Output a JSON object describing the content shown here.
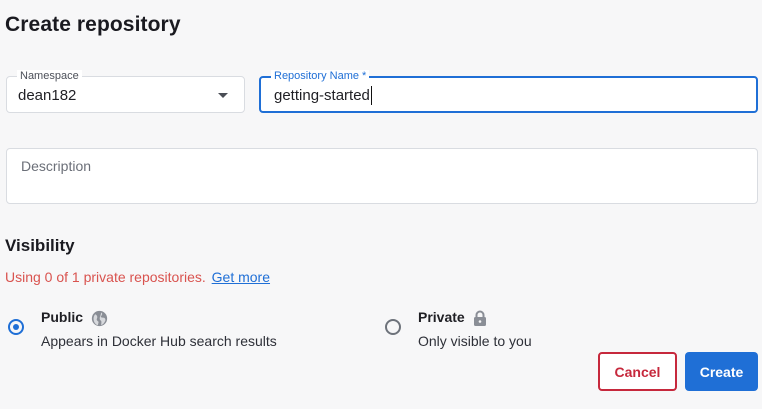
{
  "page": {
    "title": "Create repository"
  },
  "namespace": {
    "label": "Namespace",
    "value": "dean182",
    "icon": "chevron-down-icon"
  },
  "repository_name": {
    "label": "Repository Name *",
    "value": "getting-started"
  },
  "description": {
    "placeholder": "Description"
  },
  "visibility": {
    "title": "Visibility",
    "usage_text": "Using 0 of 1 private repositories.",
    "get_more_link": "Get more",
    "options": [
      {
        "title": "Public",
        "icon": "globe-icon",
        "description": "Appears in Docker Hub search results",
        "selected": true
      },
      {
        "title": "Private",
        "icon": "lock-icon",
        "description": "Only visible to you",
        "selected": false
      }
    ]
  },
  "actions": {
    "cancel_label": "Cancel",
    "create_label": "Create"
  },
  "colors": {
    "accent": "#1f6fd6",
    "danger": "#c6283c",
    "warning_text": "#d9534f",
    "background": "#f7f7f8"
  }
}
